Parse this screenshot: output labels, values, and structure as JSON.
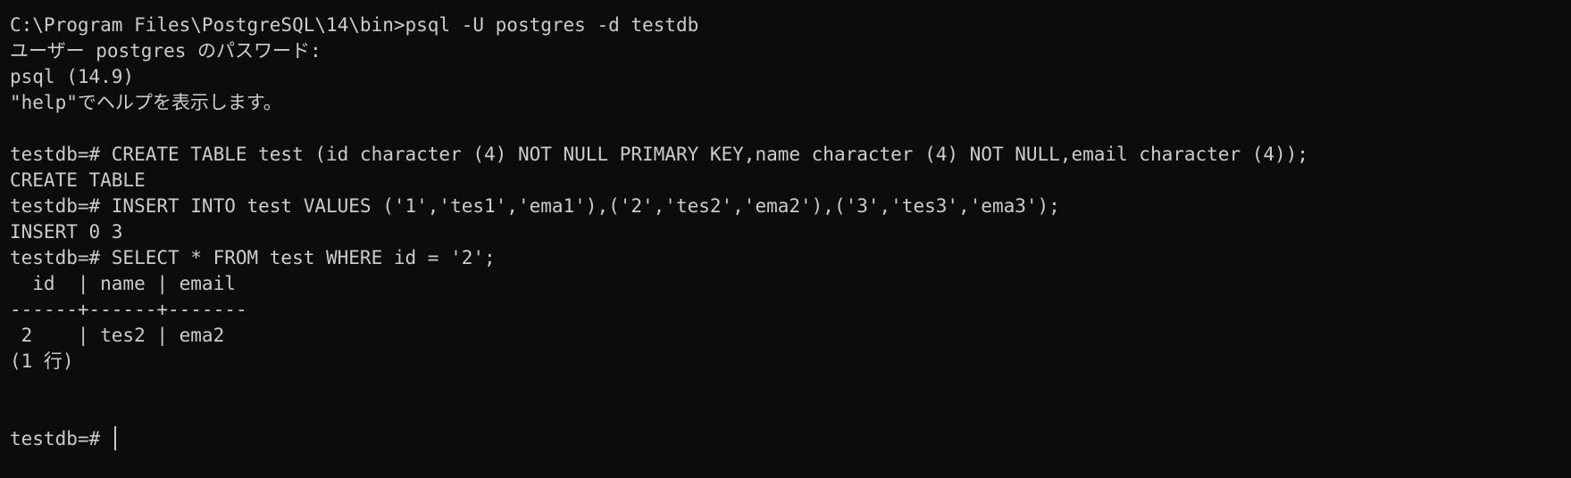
{
  "terminal": {
    "lines": [
      "C:\\Program Files\\PostgreSQL\\14\\bin>psql -U postgres -d testdb",
      "ユーザー postgres のパスワード:",
      "psql (14.9)",
      "\"help\"でヘルプを表示します。",
      "",
      "testdb=# CREATE TABLE test (id character (4) NOT NULL PRIMARY KEY,name character (4) NOT NULL,email character (4));",
      "CREATE TABLE",
      "testdb=# INSERT INTO test VALUES ('1','tes1','ema1'),('2','tes2','ema2'),('3','tes3','ema3');",
      "INSERT 0 3",
      "testdb=# SELECT * FROM test WHERE id = '2';",
      "  id  | name | email",
      "------+------+-------",
      " 2    | tes2 | ema2",
      "(1 行)",
      "",
      ""
    ],
    "prompt": "testdb=# ",
    "colors": {
      "background": "#0c0c0c",
      "foreground": "#cccccc"
    }
  }
}
